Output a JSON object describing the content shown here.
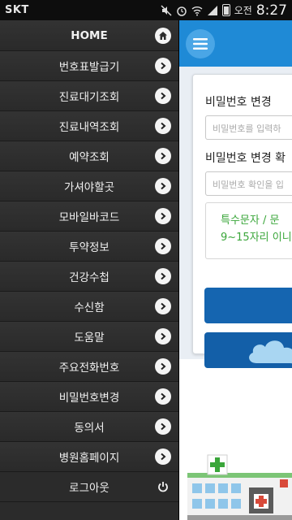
{
  "status_bar": {
    "carrier": "SKT",
    "ampm": "오전",
    "time": "8:27"
  },
  "drawer": {
    "items": [
      {
        "label": "HOME",
        "icon": "home-icon"
      },
      {
        "label": "번호표발급기",
        "icon": "chevron-right-icon"
      },
      {
        "label": "진료대기조회",
        "icon": "chevron-right-icon"
      },
      {
        "label": "진료내역조회",
        "icon": "chevron-right-icon"
      },
      {
        "label": "예약조회",
        "icon": "chevron-right-icon"
      },
      {
        "label": "가셔야할곳",
        "icon": "chevron-right-icon"
      },
      {
        "label": "모바일바코드",
        "icon": "chevron-right-icon"
      },
      {
        "label": "투약정보",
        "icon": "chevron-right-icon"
      },
      {
        "label": "건강수첩",
        "icon": "chevron-right-icon"
      },
      {
        "label": "수신함",
        "icon": "chevron-right-icon"
      },
      {
        "label": "도움말",
        "icon": "chevron-right-icon"
      },
      {
        "label": "주요전화번호",
        "icon": "chevron-right-icon"
      },
      {
        "label": "비밀번호변경",
        "icon": "chevron-right-icon"
      },
      {
        "label": "동의서",
        "icon": "chevron-right-icon"
      },
      {
        "label": "병원홈페이지",
        "icon": "chevron-right-icon"
      },
      {
        "label": "로그아웃",
        "icon": "power-icon"
      }
    ]
  },
  "main": {
    "password_label": "비밀번호 변경",
    "password_placeholder": "비밀번호를 입력하",
    "confirm_label": "비밀번호 변경 확",
    "confirm_placeholder": "비밀번호 확인을 입",
    "hint_line1": "특수문자 / 문",
    "hint_line2": "9~15자리 이니"
  },
  "colors": {
    "appbar": "#1f8ad6",
    "button": "#1565b0",
    "hint_text": "#3aa63a",
    "drawer_bg": "#2b2b2b"
  }
}
